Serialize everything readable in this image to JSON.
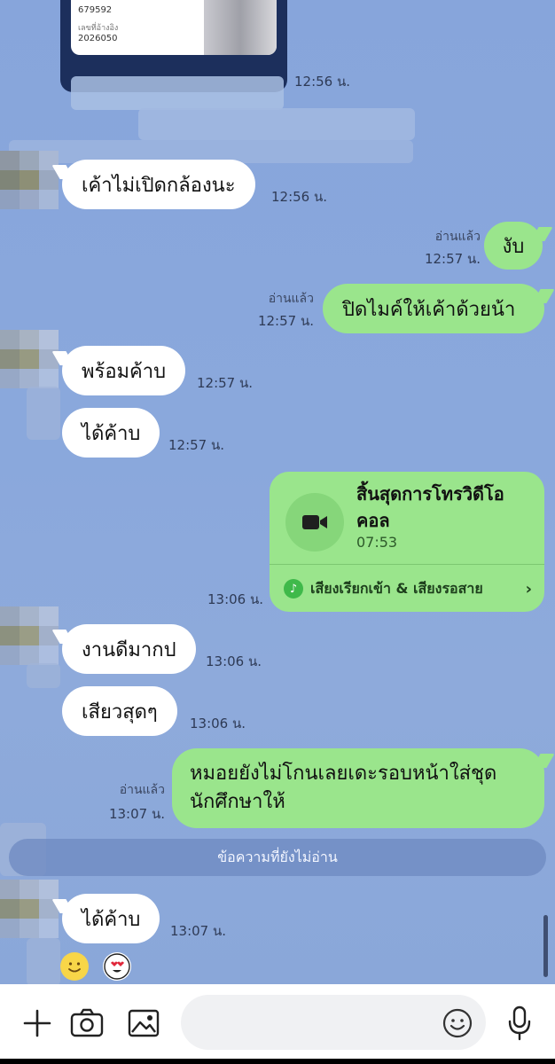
{
  "top_card": {
    "line1": "679592",
    "line2": "เลขที่อ้างอิง",
    "line3": "2026050"
  },
  "messages": [
    {
      "text": "เค้าไม่เปิดกล้องนะ",
      "time": "12:56 น."
    },
    {
      "text": "งับ",
      "time": "12:57 น.",
      "read": "อ่านแล้ว"
    },
    {
      "text": "ปิดไมค์ให้เค้าด้วยน้า",
      "time": "12:57 น.",
      "read": "อ่านแล้ว"
    },
    {
      "text": "พร้อมค้าบ",
      "time": "12:57 น."
    },
    {
      "text": "ได้ค้าบ",
      "time": "12:57 น."
    },
    {
      "text": "งานดีมากป",
      "time": "13:06 น."
    },
    {
      "text": "เสียวสุดๆ",
      "time": "13:06 น."
    },
    {
      "text": "หมอยยังไม่โกนเลยเดะรอบหน้าใส่ชุดนักศึกษาให้",
      "line1": "หมอยยังไม่โกนเลยเดะรอบหน้าใส่ชุด",
      "line2": "นักศึกษาให้",
      "time": "13:07 น.",
      "read": "อ่านแล้ว"
    },
    {
      "text": "ได้ค้าบ",
      "time": "13:07 น."
    }
  ],
  "first_time": "12:56 น.",
  "call": {
    "title_line1": "สิ้นสุดการโทรวิดีโอ",
    "title_line2": "คอล",
    "duration": "07:53",
    "footer": "เสียงเรียกเข้า & เสียงรอสาย",
    "time": "13:06 น.",
    "icon": "video-camera-icon"
  },
  "unread_divider": "ข้อความที่ยังไม่อ่าน",
  "reactions": [
    "smile-emoji",
    "heart-eyes-emoji"
  ],
  "input": {
    "placeholder": ""
  },
  "toolbar_icons": [
    "plus-icon",
    "camera-icon",
    "image-icon",
    "emoji-icon",
    "microphone-icon"
  ],
  "colors": {
    "background": "#8aa7d9",
    "incoming": "#ffffff",
    "outgoing": "#9ae58c"
  }
}
